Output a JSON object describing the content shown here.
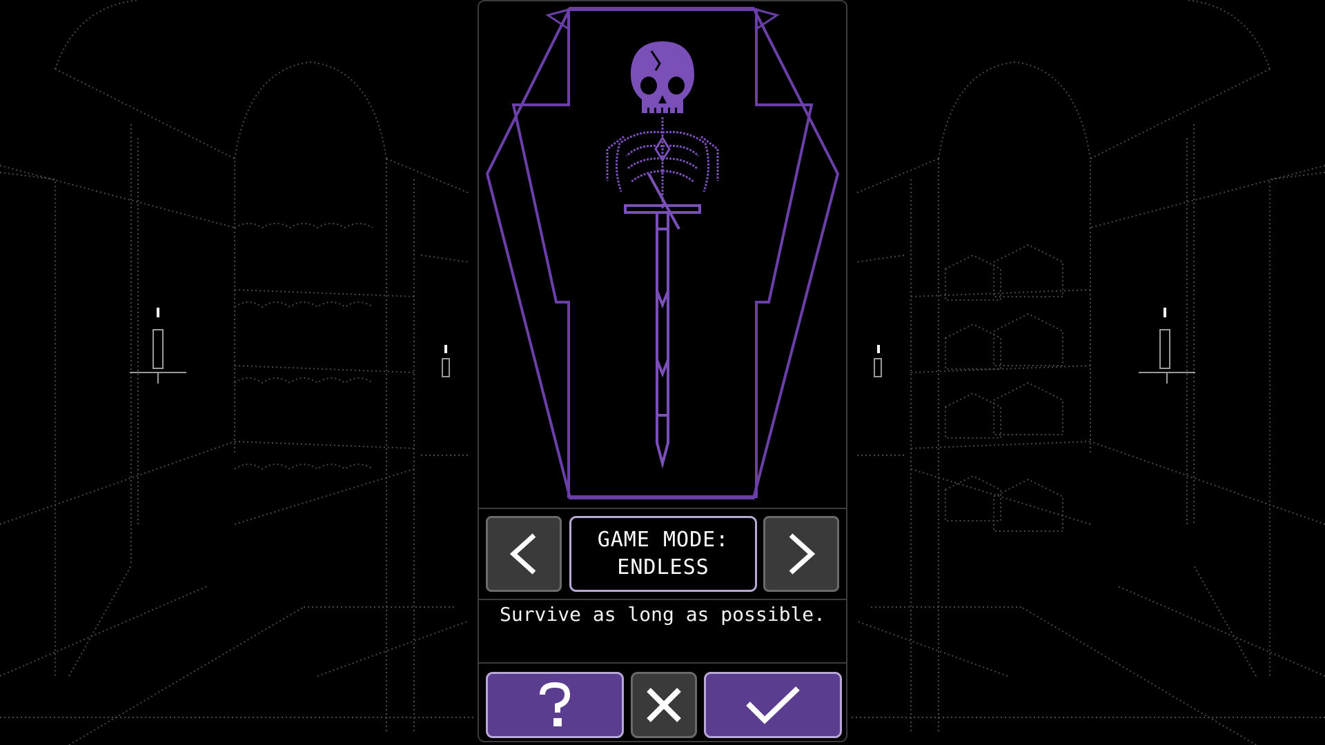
{
  "mode_selector": {
    "title_line": "GAME MODE:",
    "mode_name": "ENDLESS",
    "description": "Survive as long as possible."
  },
  "icons": {
    "prev": "chevron-left-icon",
    "next": "chevron-right-icon",
    "help": "question-icon",
    "cancel": "close-icon",
    "confirm": "check-icon",
    "art": "skeleton-coffin-illustration"
  },
  "colors": {
    "background": "#000000",
    "accent_purple": "#5b3d8f",
    "accent_border": "#b8a8d8",
    "coffin_line": "#6a3fa8",
    "skeleton": "#7a4fb8",
    "grey_button": "#3a3a3a",
    "text": "#ffffff",
    "scenery_dots": "#4a4a4a"
  }
}
